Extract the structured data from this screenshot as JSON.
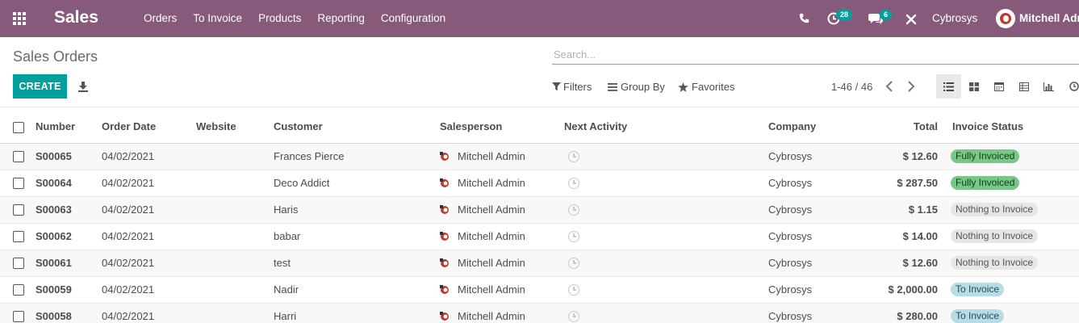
{
  "navbar": {
    "brand": "Sales",
    "menu": [
      "Orders",
      "To Invoice",
      "Products",
      "Reporting",
      "Configuration"
    ],
    "activities_count": "28",
    "messages_count": "6",
    "company": "Cybrosys",
    "user": "Mitchell Admin"
  },
  "control": {
    "title": "Sales Orders",
    "search_placeholder": "Search...",
    "create_label": "CREATE",
    "filters_label": "Filters",
    "groupby_label": "Group By",
    "favorites_label": "Favorites",
    "pager": "1-46 / 46"
  },
  "table": {
    "headers": {
      "number": "Number",
      "order_date": "Order Date",
      "website": "Website",
      "customer": "Customer",
      "salesperson": "Salesperson",
      "next_activity": "Next Activity",
      "company": "Company",
      "total": "Total",
      "invoice_status": "Invoice Status"
    },
    "rows": [
      {
        "number": "S00065",
        "date": "04/02/2021",
        "customer": "Frances Pierce",
        "salesperson": "Mitchell Admin",
        "company": "Cybrosys",
        "total": "$ 12.60",
        "status": "Fully Invoiced",
        "status_kind": "green"
      },
      {
        "number": "S00064",
        "date": "04/02/2021",
        "customer": "Deco Addict",
        "salesperson": "Mitchell Admin",
        "company": "Cybrosys",
        "total": "$ 287.50",
        "status": "Fully Invoiced",
        "status_kind": "green"
      },
      {
        "number": "S00063",
        "date": "04/02/2021",
        "customer": "Haris",
        "salesperson": "Mitchell Admin",
        "company": "Cybrosys",
        "total": "$ 1.15",
        "status": "Nothing to Invoice",
        "status_kind": "gray"
      },
      {
        "number": "S00062",
        "date": "04/02/2021",
        "customer": "babar",
        "salesperson": "Mitchell Admin",
        "company": "Cybrosys",
        "total": "$ 14.00",
        "status": "Nothing to Invoice",
        "status_kind": "gray"
      },
      {
        "number": "S00061",
        "date": "04/02/2021",
        "customer": "test",
        "salesperson": "Mitchell Admin",
        "company": "Cybrosys",
        "total": "$ 12.60",
        "status": "Nothing to Invoice",
        "status_kind": "gray"
      },
      {
        "number": "S00059",
        "date": "04/02/2021",
        "customer": "Nadir",
        "salesperson": "Mitchell Admin",
        "company": "Cybrosys",
        "total": "$ 2,000.00",
        "status": "To Invoice",
        "status_kind": "blue"
      },
      {
        "number": "S00058",
        "date": "04/02/2021",
        "customer": "Harri",
        "salesperson": "Mitchell Admin",
        "company": "Cybrosys",
        "total": "$ 280.00",
        "status": "To Invoice",
        "status_kind": "blue"
      }
    ]
  },
  "colors": {
    "navbar": "#875a7b",
    "primary": "#00a09d",
    "status_green": "#77c787",
    "status_gray": "#e6e6e6",
    "status_blue": "#b8dce6"
  }
}
